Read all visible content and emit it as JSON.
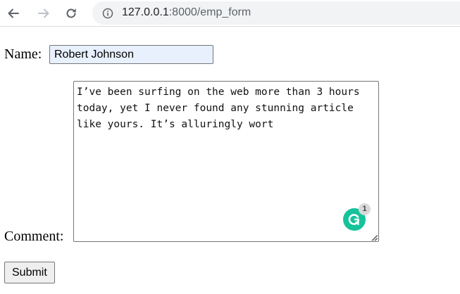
{
  "browser": {
    "url_host": "127.0.0.1",
    "url_path": ":8000/emp_form",
    "nav_icons": [
      "back-arrow-icon",
      "forward-arrow-icon",
      "reload-icon",
      "info-icon"
    ]
  },
  "form": {
    "name_label": "Name:",
    "name_value": "Robert Johnson",
    "comment_label": "Comment:",
    "comment_value": "I’ve been surfing on the web more than 3 hours today, yet I never found any stunning article like yours. It’s alluringly wort",
    "submit_label": "Submit"
  },
  "grammarly": {
    "issue_count": "1",
    "color": "#15c39a"
  },
  "colors": {
    "autofill_background": "#e8f0fe",
    "omnibox_background": "#f1f3f4"
  }
}
